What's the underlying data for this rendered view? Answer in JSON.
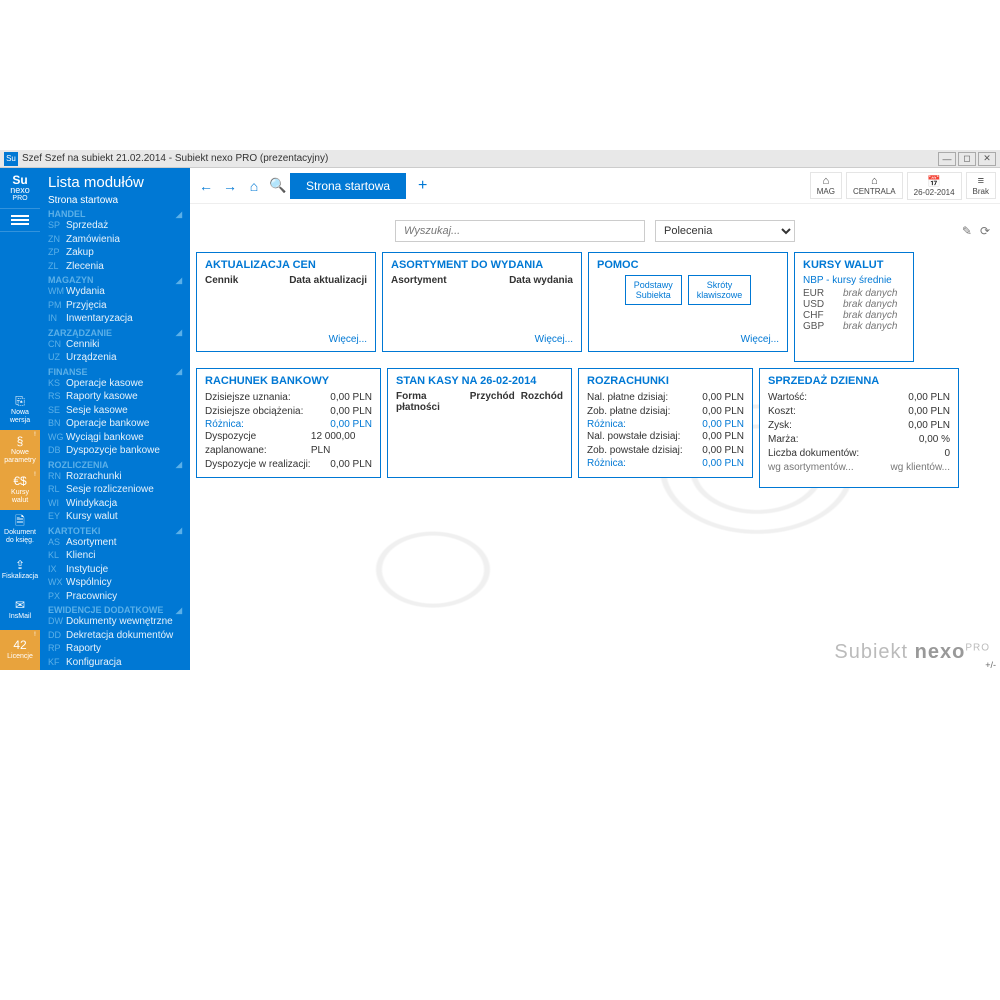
{
  "window": {
    "title": "Szef Szef na subiekt 21.02.2014 - Subiekt nexo PRO (prezentacyjny)",
    "icon_text": "Su"
  },
  "logo": {
    "line1": "Su",
    "line2": "nexo",
    "line3": "PRO"
  },
  "strip": {
    "items": [
      {
        "label": "Nowa\nwersja",
        "icon": "⎘",
        "orange": false,
        "badge": ""
      },
      {
        "label": "Nowe\nparametry",
        "icon": "§",
        "orange": true,
        "badge": "!"
      },
      {
        "label": "Kursy\nwalut",
        "icon": "€$",
        "orange": true,
        "badge": "!"
      },
      {
        "label": "Dokument\ndo księg.",
        "icon": "🗎",
        "orange": false,
        "badge": ""
      },
      {
        "label": "Fiskalizacja",
        "icon": "⇪",
        "orange": false,
        "badge": ""
      },
      {
        "label": "InsMail",
        "icon": "✉",
        "orange": false,
        "badge": ""
      },
      {
        "label": "Licencje",
        "icon": "42",
        "orange": true,
        "badge": "!"
      }
    ]
  },
  "sidebar": {
    "title": "Lista modułów",
    "start": "Strona startowa",
    "groups": [
      {
        "name": "HANDEL",
        "items": [
          {
            "code": "SP",
            "label": "Sprzedaż"
          },
          {
            "code": "ZN",
            "label": "Zamówienia"
          },
          {
            "code": "ZP",
            "label": "Zakup"
          },
          {
            "code": "ZL",
            "label": "Zlecenia"
          }
        ]
      },
      {
        "name": "MAGAZYN",
        "items": [
          {
            "code": "WM",
            "label": "Wydania"
          },
          {
            "code": "PM",
            "label": "Przyjęcia"
          },
          {
            "code": "IN",
            "label": "Inwentaryzacja"
          }
        ]
      },
      {
        "name": "ZARZĄDZANIE",
        "items": [
          {
            "code": "CN",
            "label": "Cenniki"
          },
          {
            "code": "UZ",
            "label": "Urządzenia"
          }
        ]
      },
      {
        "name": "FINANSE",
        "items": [
          {
            "code": "KS",
            "label": "Operacje kasowe"
          },
          {
            "code": "RS",
            "label": "Raporty kasowe"
          },
          {
            "code": "SE",
            "label": "Sesje kasowe"
          },
          {
            "code": "BN",
            "label": "Operacje bankowe"
          },
          {
            "code": "WG",
            "label": "Wyciągi bankowe"
          },
          {
            "code": "DB",
            "label": "Dyspozycje bankowe"
          }
        ]
      },
      {
        "name": "ROZLICZENIA",
        "items": [
          {
            "code": "RN",
            "label": "Rozrachunki"
          },
          {
            "code": "RL",
            "label": "Sesje rozliczeniowe"
          },
          {
            "code": "WI",
            "label": "Windykacja"
          },
          {
            "code": "EY",
            "label": "Kursy walut"
          }
        ]
      },
      {
        "name": "KARTOTEKI",
        "items": [
          {
            "code": "AS",
            "label": "Asortyment"
          },
          {
            "code": "KL",
            "label": "Klienci"
          },
          {
            "code": "IX",
            "label": "Instytucje"
          },
          {
            "code": "WX",
            "label": "Wspólnicy"
          },
          {
            "code": "PX",
            "label": "Pracownicy"
          }
        ]
      },
      {
        "name": "EWIDENCJE DODATKOWE",
        "items": [
          {
            "code": "DW",
            "label": "Dokumenty wewnętrzne"
          },
          {
            "code": "DD",
            "label": "Dekretacja dokumentów"
          },
          {
            "code": "RP",
            "label": "Raporty"
          },
          {
            "code": "KF",
            "label": "Konfiguracja"
          }
        ]
      }
    ]
  },
  "topbar": {
    "tab_active": "Strona startowa",
    "tiles": [
      {
        "icon": "⌂",
        "label": "MAG"
      },
      {
        "icon": "⌂",
        "label": "CENTRALA"
      },
      {
        "icon": "📅",
        "label": "26-02-2014"
      },
      {
        "icon": "≡",
        "label": "Brak"
      }
    ]
  },
  "search": {
    "placeholder": "Wyszukaj...",
    "select": "Polecenia"
  },
  "cards": {
    "aktualizacja": {
      "title": "AKTUALIZACJA CEN",
      "h1": "Cennik",
      "h2": "Data aktualizacji",
      "more": "Więcej..."
    },
    "asortyment": {
      "title": "ASORTYMENT DO WYDANIA",
      "h1": "Asortyment",
      "h2": "Data wydania",
      "more": "Więcej..."
    },
    "pomoc": {
      "title": "POMOC",
      "btn1": "Podstawy\nSubiekta",
      "btn2": "Skróty\nklawiszowe",
      "more": "Więcej..."
    },
    "kursy": {
      "title": "KURSY WALUT",
      "sub": "NBP - kursy średnie",
      "rows": [
        {
          "c": "EUR",
          "v": "brak danych"
        },
        {
          "c": "USD",
          "v": "brak danych"
        },
        {
          "c": "CHF",
          "v": "brak danych"
        },
        {
          "c": "GBP",
          "v": "brak danych"
        }
      ]
    },
    "rachunek": {
      "title": "RACHUNEK BANKOWY",
      "r1l": "Dzisiejsze uznania:",
      "r1v": "0,00 PLN",
      "r2l": "Dzisiejsze obciążenia:",
      "r2v": "0,00 PLN",
      "diffL": "Różnica:",
      "diffV": "0,00 PLN",
      "r3l": "Dyspozycje zaplanowane:",
      "r3v": "12 000,00 PLN",
      "r4l": "Dyspozycje w realizacji:",
      "r4v": "0,00 PLN"
    },
    "stankasy": {
      "title": "STAN KASY NA 26-02-2014",
      "h1": "Forma płatności",
      "h2": "Przychód",
      "h3": "Rozchód"
    },
    "rozrachunki": {
      "title": "ROZRACHUNKI",
      "r1l": "Nal. płatne dzisiaj:",
      "r1v": "0,00 PLN",
      "r2l": "Zob. płatne dzisiaj:",
      "r2v": "0,00 PLN",
      "d1l": "Różnica:",
      "d1v": "0,00 PLN",
      "r3l": "Nal. powstałe dzisiaj:",
      "r3v": "0,00 PLN",
      "r4l": "Zob. powstałe dzisiaj:",
      "r4v": "0,00 PLN",
      "d2l": "Różnica:",
      "d2v": "0,00 PLN"
    },
    "sprzedaz": {
      "title": "SPRZEDAŻ DZIENNA",
      "r1l": "Wartość:",
      "r1v": "0,00 PLN",
      "r2l": "Koszt:",
      "r2v": "0,00 PLN",
      "r3l": "Zysk:",
      "r3v": "0,00 PLN",
      "r4l": "Marża:",
      "r4v": "0,00 %",
      "r5l": "Liczba dokumentów:",
      "r5v": "0",
      "f1": "wg asortymentów...",
      "f2": "wg klientów..."
    }
  },
  "brand": {
    "t1": "Subiekt",
    "t2": "nexo",
    "t3": "PRO"
  },
  "plusminus": "+/-"
}
